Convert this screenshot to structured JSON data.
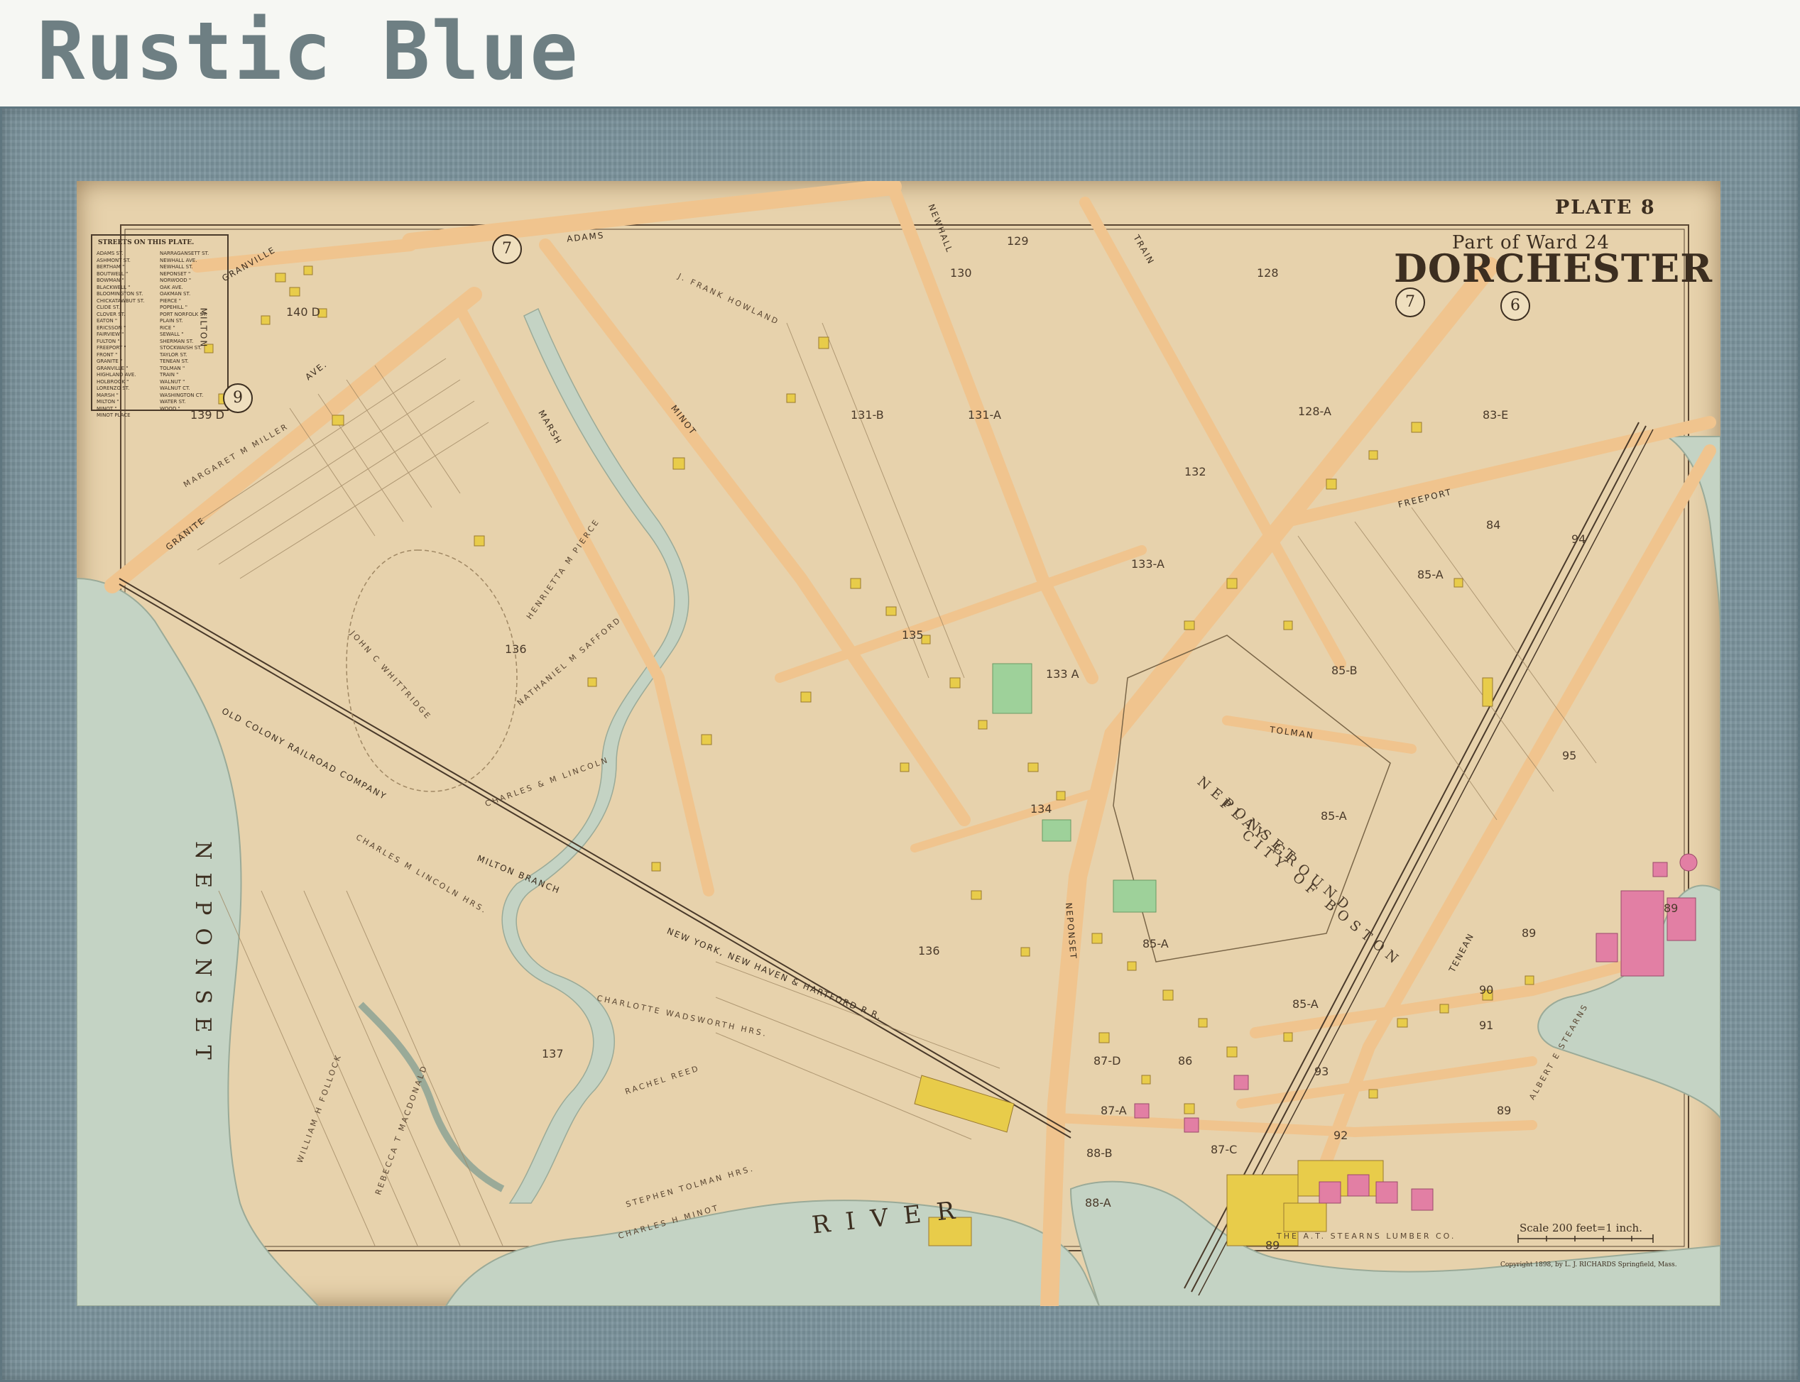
{
  "product": {
    "title": "Rustic Blue"
  },
  "map": {
    "plate": "PLATE 8",
    "ward": "Part of Ward 24",
    "town": "DORCHESTER",
    "scale": "Scale 200 feet=1 inch.",
    "copyright": "Copyright 1898, by L. J. RICHARDS Springfield, Mass.",
    "streets_title": "STREETS ON THIS PLATE.",
    "streets_col1": [
      "ADAMS ST.",
      "ASHMONT ST.",
      "BERTHAM \"",
      "BOUTWELL \"",
      "BOWMAN \"",
      "BLACKWELL \"",
      "BLOOMINGTON ST.",
      "CHICKATAWBUT ST.",
      "CLIDE ST.",
      "CLOVER ST.",
      "EATON \"",
      "ERICSSON \"",
      "FAIRVIEW \"",
      "FULTON \"",
      "FREEPORT \"",
      "FRONT \"",
      "GRANITE \"",
      "GRANVILLE \"",
      "HIGHLAND AVE.",
      "HOLBROOK \"",
      "LORENZO ST.",
      "MARSH \"",
      "MILTON \"",
      "MINOT \"",
      "MINOT PLACE"
    ],
    "streets_col2": [
      "NARRAGANSETT ST.",
      "NEWHALL AVE.",
      "NEWHALL ST.",
      "NEPONSET \"",
      "NORWOOD \"",
      "OAK AVE.",
      "OAKMAN ST.",
      "PIERCE \"",
      "POPEHILL \"",
      "PORT NORFOLK ST.",
      "PLAIN ST.",
      "RICE \"",
      "SEWALL \"",
      "SHERMAN ST.",
      "STOCKWAISH ST.",
      "TAYLOR ST.",
      "TENEAN ST.",
      "TOLMAN \"",
      "TRAIN \"",
      "WALNUT \"",
      "WALNUT CT.",
      "WASHINGTON CT.",
      "WATER ST.",
      "WOOD \""
    ],
    "river_vertical": "NEPONSET",
    "river_horizontal": "RIVER",
    "playground": [
      "NEPONSET",
      "PLAY GROUND",
      "CITY OF BOSTON"
    ],
    "ward_circles": [
      "7",
      "7",
      "6",
      "9"
    ],
    "plots": [
      "129",
      "130",
      "128",
      "131-B",
      "131-A",
      "128-A",
      "83-E",
      "140 D",
      "139 D",
      "132",
      "133-A",
      "84",
      "85-A",
      "94",
      "135",
      "133 A",
      "85-B",
      "136",
      "95",
      "134",
      "85-A",
      "136",
      "85-A",
      "89",
      "90",
      "91",
      "137",
      "86",
      "87-D",
      "93",
      "87-A",
      "88-B",
      "92",
      "89",
      "88-A",
      "89",
      "87-C",
      "85-A",
      "89"
    ],
    "owners": [
      "JOHN C WHITTRIDGE",
      "HENRIETTA M PIERCE",
      "NATHANIEL M SAFFORD",
      "CHARLES & M LINCOLN",
      "CHARLES M LINCOLN HRS.",
      "CHARLOTTE WADSWORTH HRS.",
      "RACHEL REED",
      "STEPHEN TOLMAN HRS.",
      "CHARLES H MINOT",
      "WILLIAM H FOLLOCK",
      "REBECCA T MACDONALD",
      "J. FRANK HOWLAND",
      "MARGARET M MILLER",
      "ALBERT E STEARNS",
      "THE A.T. STEARNS LUMBER CO."
    ],
    "roads": [
      "ADAMS",
      "GRANITE",
      "GRANVILLE",
      "MILTON",
      "AVE.",
      "MARSH",
      "MINOT",
      "NEWHALL",
      "TRAIN",
      "NEPONSET",
      "FREEPORT",
      "TOLMAN",
      "TENEAN",
      "MILTON BRANCH",
      "NEW YORK, NEW HAVEN & HARTFORD R.R.",
      "OLD COLONY RAILROAD COMPANY"
    ],
    "colors": {
      "paper": "#e7d2ac",
      "water": "#c4d3c4",
      "road": "#f0c48e",
      "building_yellow": "#e8cc4a",
      "building_pink": "#e27fa4",
      "park_green": "#9ed19a",
      "ink": "#3c2e20",
      "frame": "#7b939c"
    }
  }
}
